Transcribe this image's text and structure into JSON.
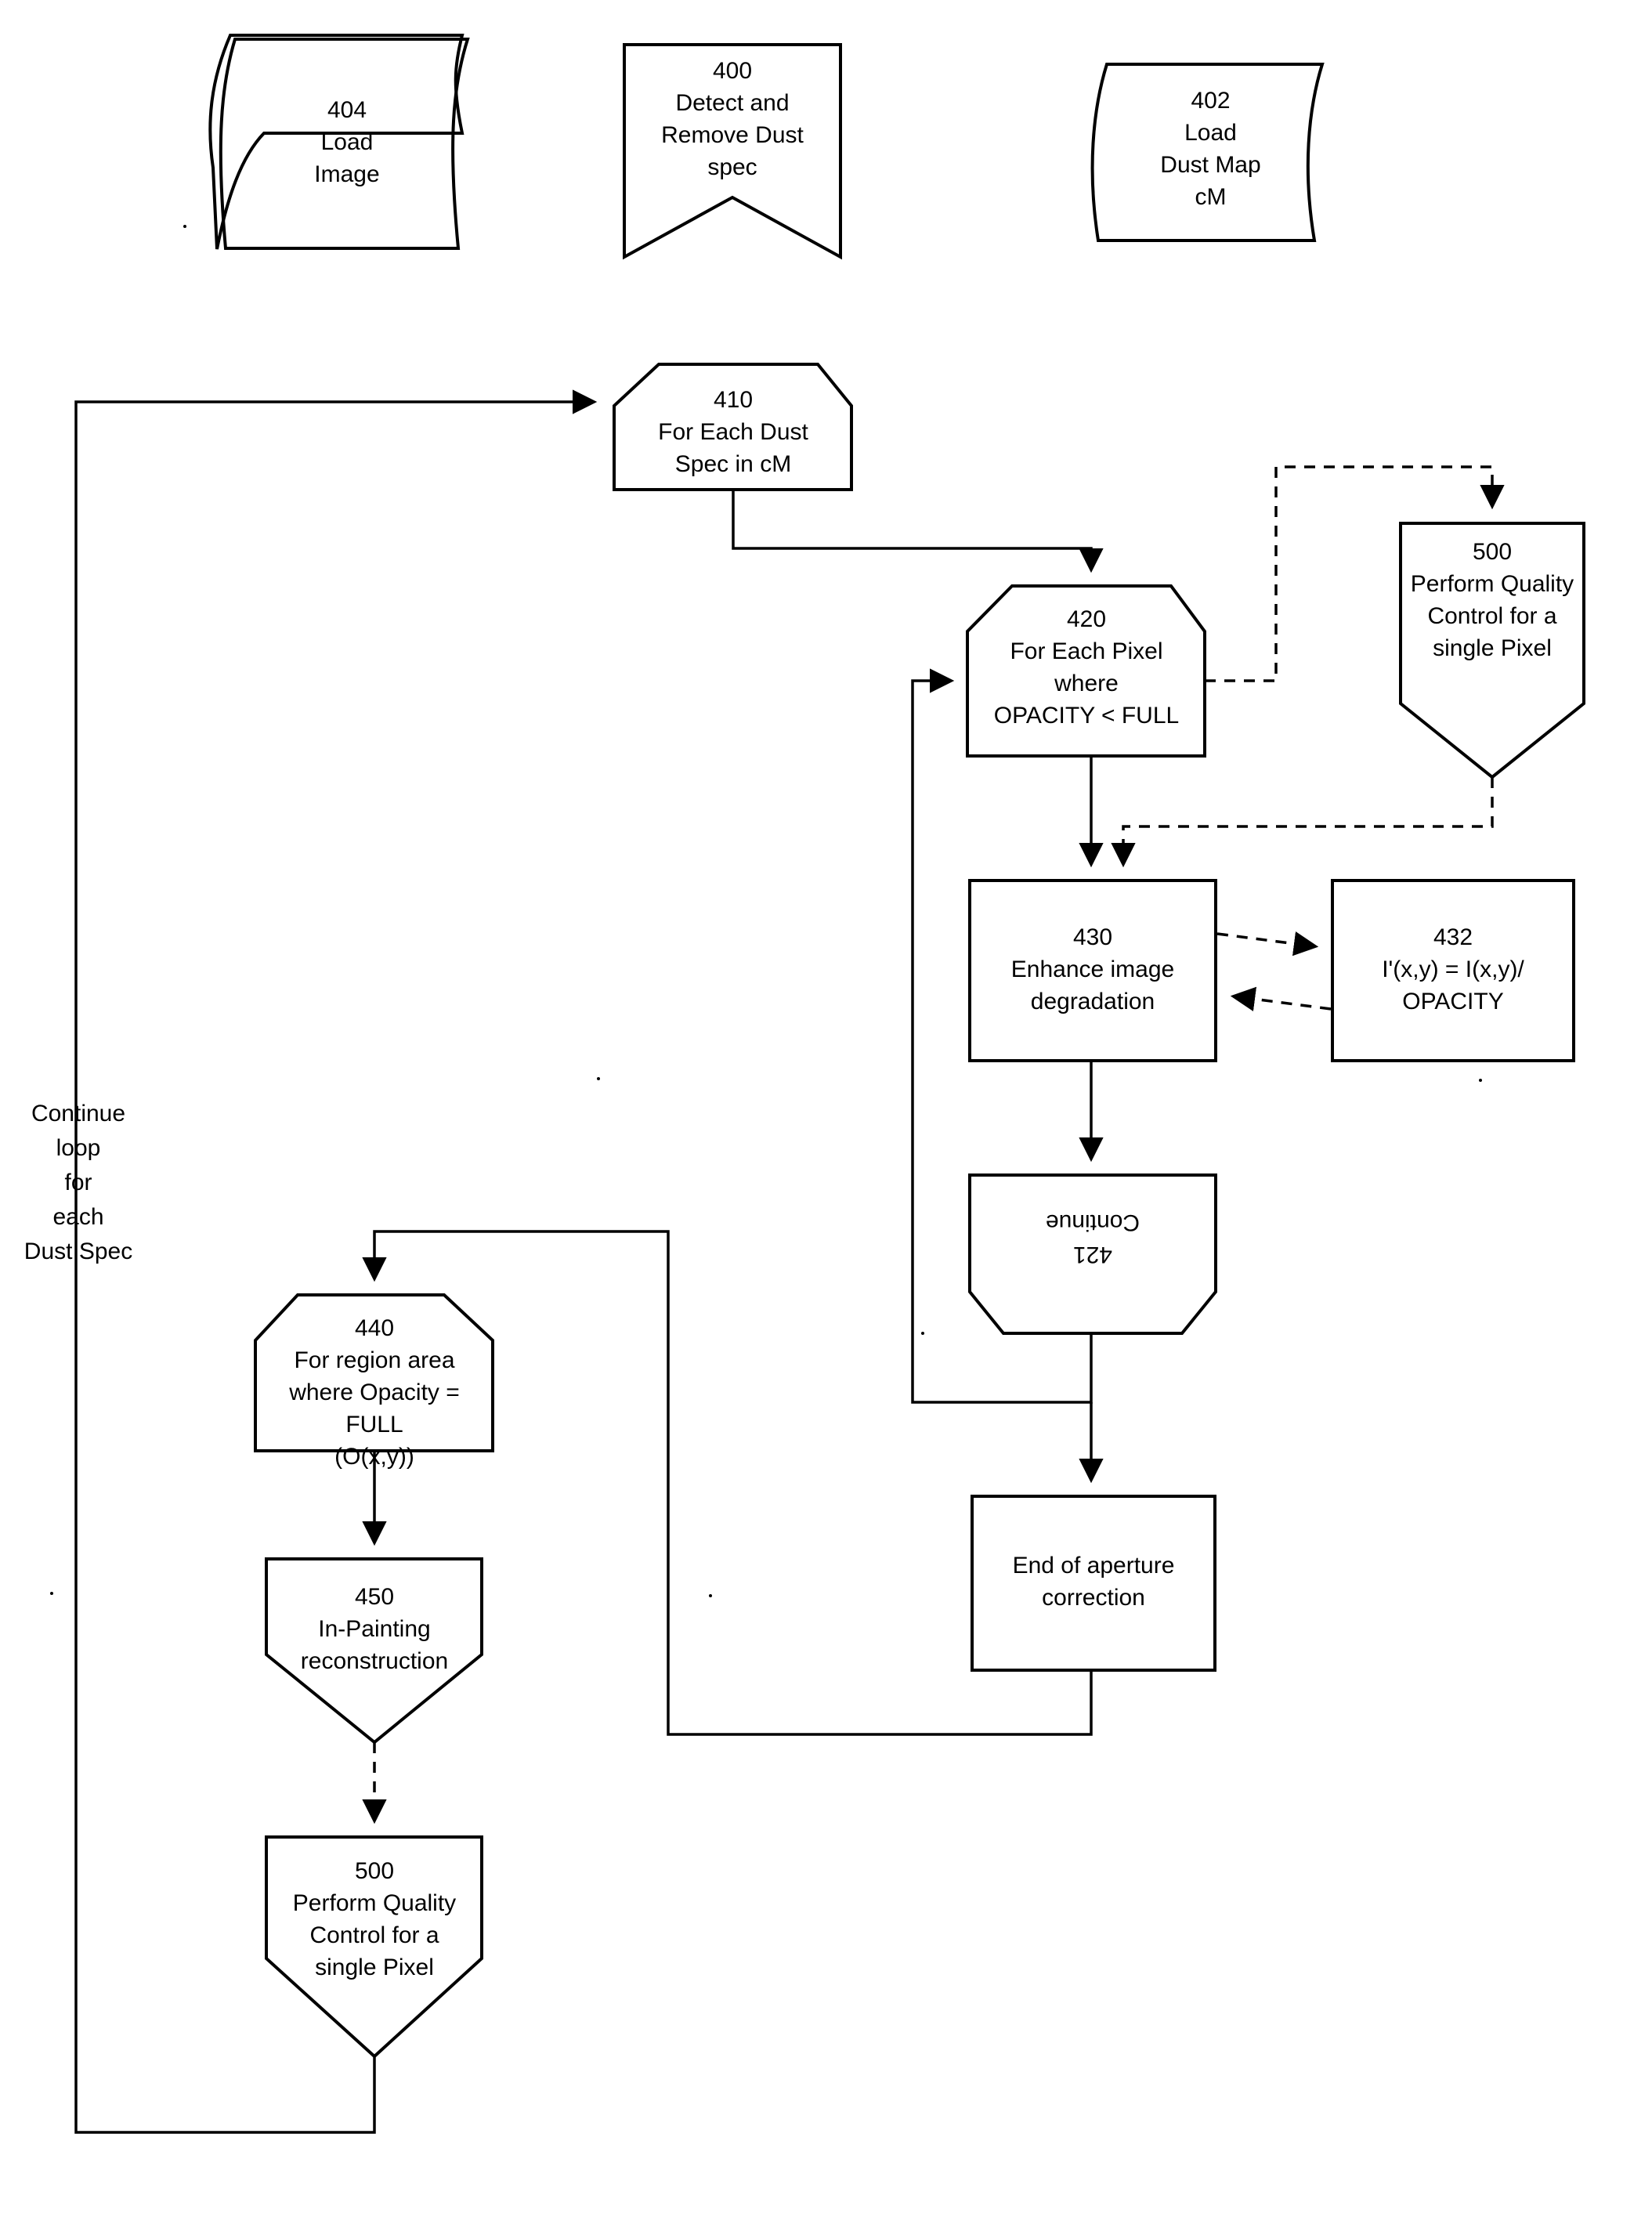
{
  "figure": {
    "type": "flowchart",
    "title": "Detect and Remove Dust spec process flow",
    "background_color": "#ffffff",
    "line_color": "#000000"
  },
  "nodes": [
    {
      "id": "404",
      "shape": "tape",
      "number": "404",
      "text": "404\nLoad\nImage"
    },
    {
      "id": "400",
      "shape": "pennant",
      "number": "400",
      "text": "400\nDetect and\nRemove Dust\nspec"
    },
    {
      "id": "402",
      "shape": "tape",
      "number": "402",
      "text": "402\nLoad\nDust Map\ncM"
    },
    {
      "id": "410",
      "shape": "chamfered-top",
      "number": "410",
      "text": "410\nFor Each Dust\nSpec in cM"
    },
    {
      "id": "420",
      "shape": "chamfered-top",
      "number": "420",
      "text": "420\nFor Each Pixel\nwhere\nOPACITY < FULL"
    },
    {
      "id": "500-top",
      "shape": "pentagon-down",
      "number": "500",
      "text": "500\nPerform Quality\nControl for a\nsingle Pixel"
    },
    {
      "id": "430",
      "shape": "rectangle",
      "number": "430",
      "text": "430\nEnhance image\ndegradation"
    },
    {
      "id": "432",
      "shape": "rectangle",
      "number": "432",
      "text": "432\nI'(x,y) = I(x,y)/\nOPACITY"
    },
    {
      "id": "421",
      "shape": "chamfered-top-rotated-180",
      "number": "421",
      "text": "421\nContinue",
      "rotated": true
    },
    {
      "id": "end-aperture",
      "shape": "rectangle",
      "number": "",
      "text": "End of aperture\ncorrection"
    },
    {
      "id": "440",
      "shape": "chamfered-top",
      "number": "440",
      "text": "440\nFor region area\nwhere Opacity =\nFULL\n(O(x,y))"
    },
    {
      "id": "450",
      "shape": "pentagon-down",
      "number": "450",
      "text": "450\nIn-Painting\nreconstruction"
    },
    {
      "id": "500-bottom",
      "shape": "pentagon-down",
      "number": "500",
      "text": "500\nPerform Quality\nControl for a\nsingle Pixel"
    }
  ],
  "annotations": [
    {
      "id": "continue-loop",
      "text": "Continue\nloop\nfor\neach\nDust Spec"
    }
  ],
  "edges": [
    {
      "from": "loop-return",
      "to": "410",
      "style": "solid"
    },
    {
      "from": "410",
      "to": "420",
      "style": "solid"
    },
    {
      "from": "420",
      "to": "500-top",
      "style": "dashed"
    },
    {
      "from": "500-top",
      "to": "430",
      "style": "dashed"
    },
    {
      "from": "420",
      "to": "430",
      "style": "solid"
    },
    {
      "from": "430",
      "to": "432",
      "style": "dashed"
    },
    {
      "from": "432",
      "to": "430",
      "style": "dashed"
    },
    {
      "from": "430",
      "to": "421",
      "style": "solid"
    },
    {
      "from": "421",
      "to": "420",
      "style": "solid"
    },
    {
      "from": "421",
      "to": "end-aperture",
      "style": "solid"
    },
    {
      "from": "end-aperture",
      "to": "440",
      "style": "solid"
    },
    {
      "from": "440",
      "to": "450",
      "style": "solid"
    },
    {
      "from": "450",
      "to": "500-bottom",
      "style": "dashed"
    },
    {
      "from": "500-bottom",
      "to": "loop-return",
      "style": "solid"
    }
  ]
}
